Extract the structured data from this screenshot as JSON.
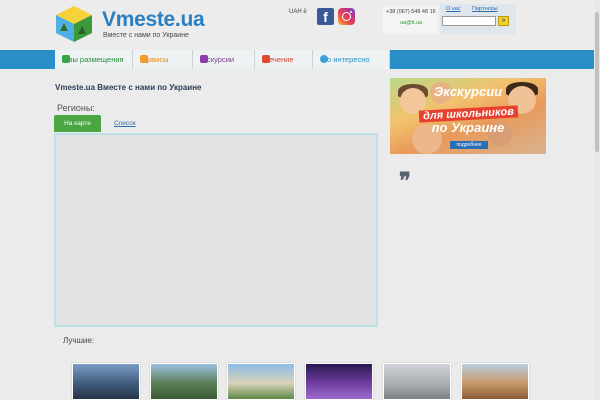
{
  "header": {
    "logo_title": "Vmeste.ua",
    "logo_subtitle": "Вместе с нами по Украине",
    "currency": "UAH ё",
    "social": {
      "facebook_glyph": "f",
      "facebook_icon": "facebook-icon",
      "instagram_icon": "instagram-icon"
    },
    "phone": "+38 (067) 548 48 16",
    "email": "ua@ti.ua",
    "about_link": "О нас",
    "partners_link": "Партнеры",
    "search_value": "",
    "search_button": "»"
  },
  "nav": {
    "items": [
      {
        "label": "зы размещения",
        "icon": "lodging-icon"
      },
      {
        "label": "рвисы",
        "icon": "services-icon"
      },
      {
        "label": "скурсии",
        "icon": "excursions-icon"
      },
      {
        "label": "ечение",
        "icon": "treatment-icon"
      },
      {
        "label": "о интересно",
        "icon": "interesting-icon"
      }
    ]
  },
  "main": {
    "heading": "Vmeste.ua Вместе с нами по Украине",
    "regions_label": "Регионы:",
    "tabs": {
      "map": "На карте",
      "list": "Список"
    }
  },
  "banner": {
    "line1": "Экскурсии",
    "line2": "для школьников",
    "line3": "по Украине",
    "more_button": "подробнее"
  },
  "quote_glyph": "❞",
  "best": {
    "label": "Лучшие:"
  },
  "colors": {
    "nav_bar": "#2a8fc6",
    "accent_green": "#4aa543",
    "link_blue": "#2a6fb5"
  }
}
